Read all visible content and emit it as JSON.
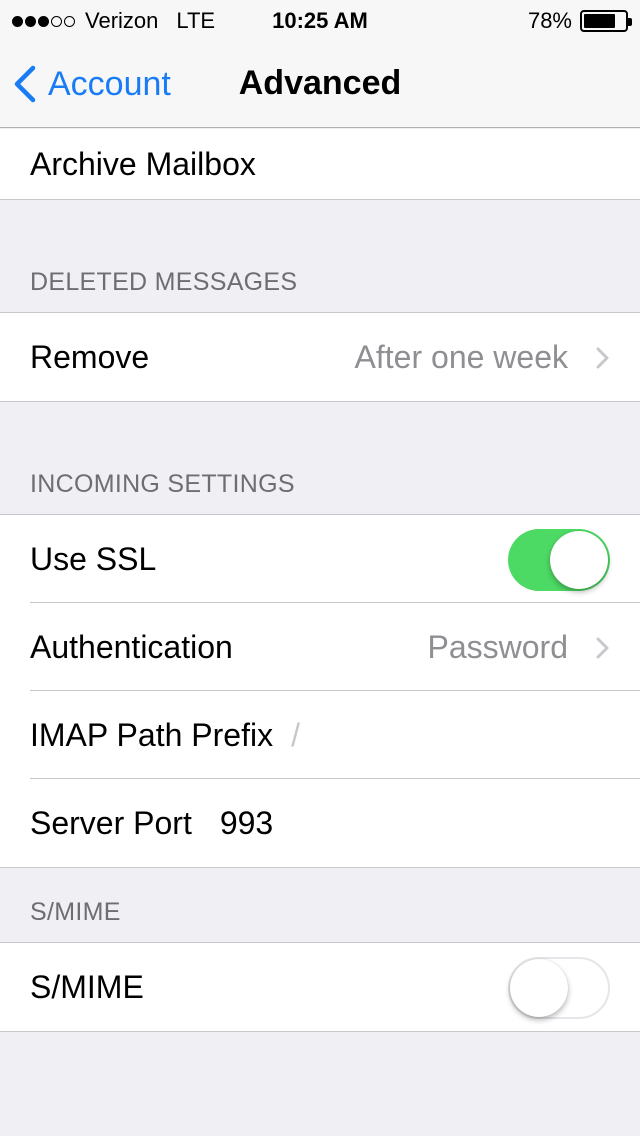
{
  "status_bar": {
    "signal_bars_filled": 3,
    "signal_bars_total": 5,
    "carrier": "Verizon",
    "network": "LTE",
    "time": "10:25 AM",
    "battery": "78%",
    "battery_level": 0.78
  },
  "nav": {
    "back_label": "Account",
    "title": "Advanced"
  },
  "top_group": {
    "archive_label": "Archive Mailbox"
  },
  "deleted_messages": {
    "header": "DELETED MESSAGES",
    "remove_label": "Remove",
    "remove_value": "After one week"
  },
  "incoming_settings": {
    "header": "INCOMING SETTINGS",
    "ssl_label": "Use SSL",
    "ssl_on": true,
    "auth_label": "Authentication",
    "auth_value": "Password",
    "imap_label": "IMAP Path Prefix",
    "imap_value": "/",
    "port_label": "Server Port",
    "port_value": "993"
  },
  "smime": {
    "header": "S/MIME",
    "label": "S/MIME",
    "on": false
  },
  "colors": {
    "accent": "#1a7cf5",
    "switch_on": "#4cd964",
    "background": "#efeff4"
  }
}
